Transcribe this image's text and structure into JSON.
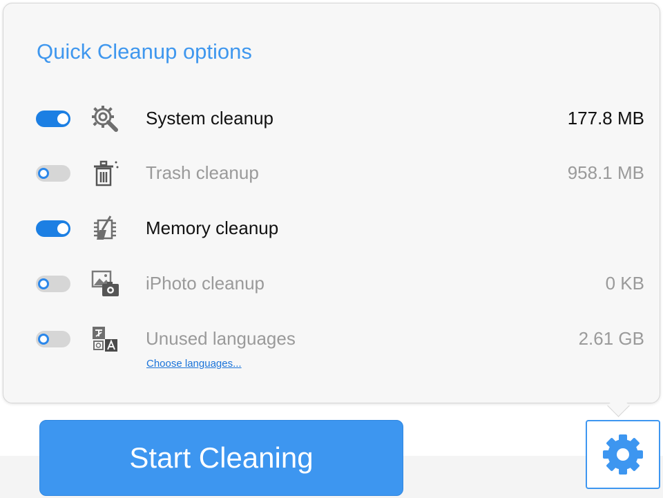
{
  "panel": {
    "title": "Quick Cleanup options"
  },
  "options": [
    {
      "label": "System cleanup",
      "size": "177.8 MB",
      "enabled": true,
      "icon": "system-gear-magnifier-icon"
    },
    {
      "label": "Trash cleanup",
      "size": "958.1 MB",
      "enabled": false,
      "icon": "trash-icon"
    },
    {
      "label": "Memory cleanup",
      "size": "",
      "enabled": true,
      "icon": "memory-chip-broom-icon"
    },
    {
      "label": "iPhoto cleanup",
      "size": "0 KB",
      "enabled": false,
      "icon": "photo-camera-icon"
    },
    {
      "label": "Unused languages",
      "size": "2.61 GB",
      "enabled": false,
      "icon": "languages-icon",
      "link": "Choose languages..."
    }
  ],
  "actions": {
    "start_label": "Start Cleaning",
    "settings_icon": "gear-icon"
  },
  "colors": {
    "accent": "#3d96f0",
    "toggle_on": "#1c7fe3",
    "toggle_off": "#d6d6d6",
    "title": "#3f97ee",
    "disabled_text": "#9a9a9a"
  }
}
